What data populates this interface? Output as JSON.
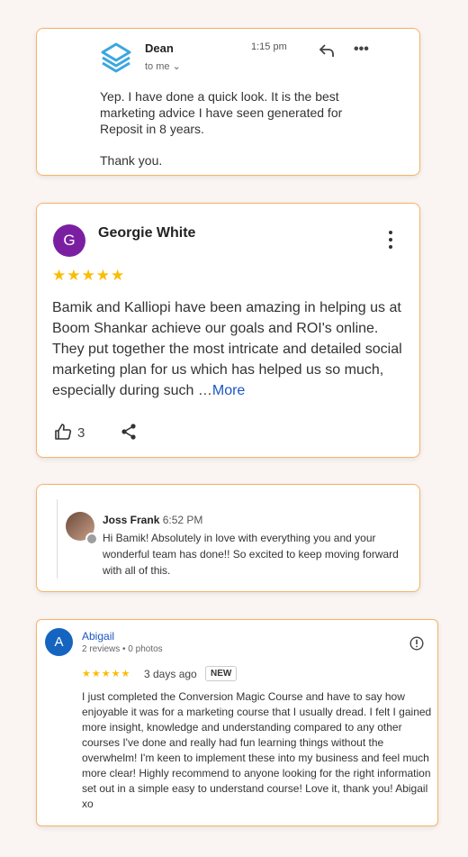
{
  "email": {
    "sender": "Dean",
    "recipient": "to me",
    "time": "1:15 pm",
    "body": [
      "Yep. I have done a quick look. It is the best marketing advice I have seen generated for Reposit in 8 years.",
      "Thank you."
    ]
  },
  "review": {
    "avatar_letter": "G",
    "name": "Georgie White",
    "stars": "★★★★★",
    "text": "Bamik and Kalliopi have been amazing in helping us at Boom Shankar achieve our goals and ROI's online. They put together the most intricate and detailed social marketing plan for us which has helped us so much, especially during such …",
    "more_label": "More",
    "like_count": "3"
  },
  "comment": {
    "name": "Joss Frank",
    "time": "6:52 PM",
    "text": "Hi Bamik! Absolutely in love with everything you and your wonderful team has done!! So excited to keep moving forward with all of this."
  },
  "review2": {
    "avatar_letter": "A",
    "name": "Abigail",
    "meta": "2 reviews • 0 photos",
    "stars": "★★★★★",
    "ago": "3 days ago",
    "badge": "NEW",
    "text": "I just completed the Conversion Magic Course and have to say how enjoyable it was for a marketing course that I usually dread. I felt I gained more insight, knowledge and understanding compared to any other courses I've done and really had fun learning things without the overwhelm! I'm keen to implement these into my business and feel much more clear! Highly recommend to anyone looking for the right information set out in a simple easy to understand course! Love it, thank you! Abigail xo"
  },
  "colors": {
    "accent_border": "#f5b46a",
    "star": "#fbbc04",
    "link": "#1a56c4",
    "avatar_g": "#7b1fa2",
    "avatar_a": "#1565c0"
  }
}
